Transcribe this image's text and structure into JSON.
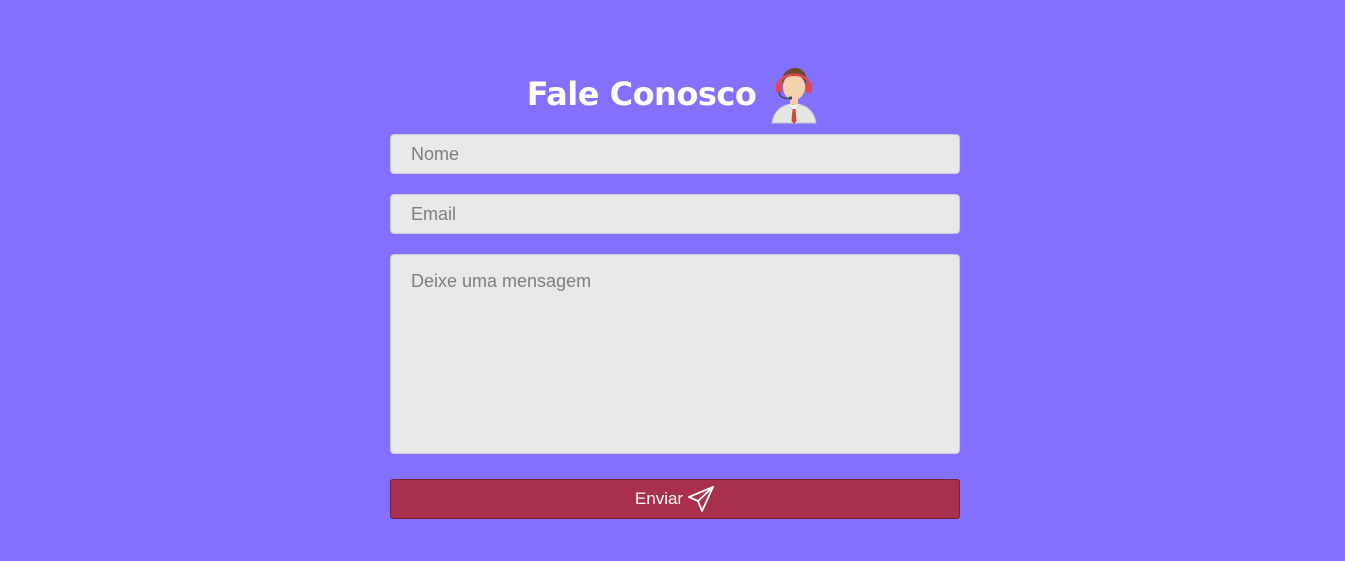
{
  "form": {
    "title": "Fale Conosco",
    "avatar_icon": "support-agent-icon",
    "name_placeholder": "Nome",
    "email_placeholder": "Email",
    "message_placeholder": "Deixe uma mensagem",
    "submit_label": "Enviar",
    "submit_icon": "paper-plane-icon"
  },
  "colors": {
    "background": "#8270ff",
    "field_background": "#e9e9e9",
    "button_background": "#a8304c",
    "title_text": "#ffffff"
  }
}
